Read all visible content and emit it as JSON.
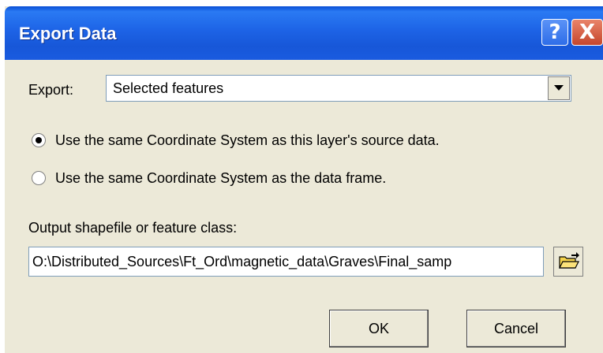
{
  "window": {
    "title": "Export Data",
    "help_label": "?",
    "close_label": "X"
  },
  "export": {
    "label": "Export:",
    "selected": "Selected features"
  },
  "coordinate_options": [
    {
      "label": "Use the same Coordinate System as this layer's source data.",
      "checked": true
    },
    {
      "label": "Use the same Coordinate System as the data frame.",
      "checked": false
    }
  ],
  "output": {
    "label": "Output shapefile or feature class:",
    "path": "O:\\Distributed_Sources\\Ft_Ord\\magnetic_data\\Graves\\Final_samp"
  },
  "buttons": {
    "ok": "OK",
    "cancel": "Cancel"
  },
  "icons": {
    "browse": "folder-open-icon",
    "dropdown": "chevron-down-icon"
  }
}
